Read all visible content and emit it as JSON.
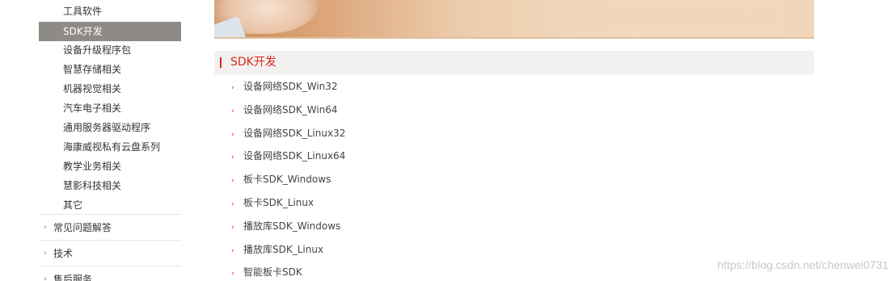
{
  "sidebar": {
    "sub_items": [
      {
        "label": "工具软件",
        "active": false
      },
      {
        "label": "SDK开发",
        "active": true
      },
      {
        "label": "设备升级程序包",
        "active": false
      },
      {
        "label": "智慧存储相关",
        "active": false
      },
      {
        "label": "机器视觉相关",
        "active": false
      },
      {
        "label": "汽车电子相关",
        "active": false
      },
      {
        "label": "通用服务器驱动程序",
        "active": false
      },
      {
        "label": "海康威视私有云盘系列",
        "active": false
      },
      {
        "label": "教学业务相关",
        "active": false
      },
      {
        "label": "慧影科技相关",
        "active": false
      },
      {
        "label": "其它",
        "active": false
      }
    ],
    "categories": [
      {
        "label": "常见问题解答",
        "arrow": "›"
      },
      {
        "label": "技术",
        "arrow": "›"
      },
      {
        "label": "售后服务",
        "arrow": "›"
      }
    ]
  },
  "section": {
    "title": "SDK开发"
  },
  "downloads": [
    {
      "label": "设备网络SDK_Win32",
      "arrow": "›"
    },
    {
      "label": "设备网络SDK_Win64",
      "arrow": "›"
    },
    {
      "label": "设备网络SDK_Linux32",
      "arrow": "›"
    },
    {
      "label": "设备网络SDK_Linux64",
      "arrow": "›"
    },
    {
      "label": "板卡SDK_Windows",
      "arrow": "›"
    },
    {
      "label": "板卡SDK_Linux",
      "arrow": "›"
    },
    {
      "label": "播放库SDK_Windows",
      "arrow": "›"
    },
    {
      "label": "播放库SDK_Linux",
      "arrow": "›"
    },
    {
      "label": "智能板卡SDK",
      "arrow": "›"
    }
  ],
  "watermark": "https://blog.csdn.net/chenwei0731",
  "colors": {
    "accent_red": "#d9261c",
    "active_bg": "#8e8b87",
    "section_bg": "#f3f1f0"
  },
  "icons": {
    "banner": "hand-on-map-banner-image",
    "list_bullet": "chevron-right-icon",
    "category_arrow": "chevron-right-icon"
  }
}
